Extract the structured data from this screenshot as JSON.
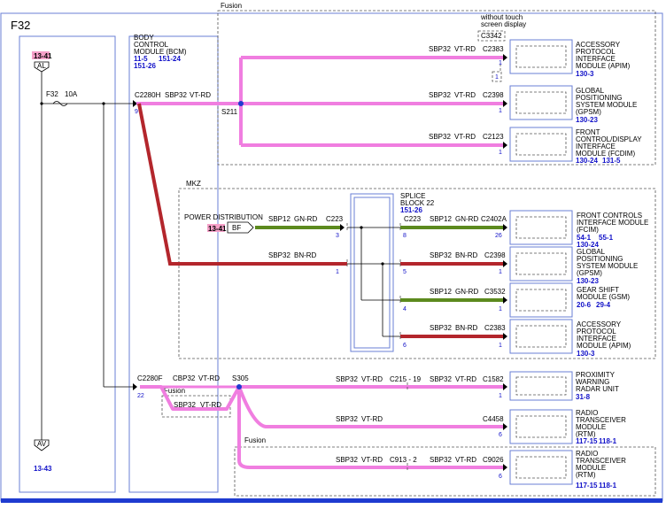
{
  "page": {
    "fuse_block": "F32"
  },
  "bcm": {
    "lines": [
      "BODY",
      "CONTROL",
      "MODULE (BCM)"
    ],
    "refs": [
      "11-5",
      "151-24",
      "151-26"
    ]
  },
  "fuse": {
    "name": "F32",
    "rating": "10A"
  },
  "left_stack": {
    "top_ref": "13-41",
    "top_label": "AL",
    "bottom_label": "AV",
    "bottom_ref": "13-43"
  },
  "fusion_top": {
    "title": "Fusion",
    "note_lines": [
      "without touch",
      "screen display"
    ],
    "note_connector": "C3342",
    "note_pin": "1",
    "splice": "S211",
    "bcm_connector": "C2280H",
    "bcm_pin": "9",
    "main_circuit": "SBP32",
    "main_color": "VT-RD"
  },
  "fusion_rows": [
    {
      "circuit": "SBP32",
      "color": "VT-RD",
      "connector": "C2383",
      "pin": "1",
      "name_lines": [
        "ACCESSORY",
        "PROTOCOL",
        "INTERFACE",
        "MODULE (APIM)"
      ],
      "refs": [
        "130-3"
      ]
    },
    {
      "circuit": "SBP32",
      "color": "VT-RD",
      "connector": "C2398",
      "pin": "1",
      "name_lines": [
        "GLOBAL",
        "POSITIONING",
        "SYSTEM MODULE",
        "(GPSM)"
      ],
      "refs": [
        "130-23"
      ]
    },
    {
      "circuit": "SBP32",
      "color": "VT-RD",
      "connector": "C2123",
      "pin": "1",
      "name_lines": [
        "FRONT",
        "CONTROL/DISPLAY",
        "INTERFACE",
        "MODULE (FCDIM)"
      ],
      "refs": [
        "130-24",
        "131-5"
      ]
    }
  ],
  "mkz": {
    "title": "MKZ",
    "splice_lines": [
      "SPLICE",
      "BLOCK 22"
    ],
    "splice_ref": "151-26",
    "power": {
      "label": "POWER DISTRIBUTION",
      "ref": "13-41",
      "tag": "BF"
    },
    "left_wires": [
      {
        "circuit": "SBP12",
        "color": "GN-RD",
        "connector": "C223",
        "pin": "3"
      },
      {
        "circuit": "SBP32",
        "color": "BN-RD",
        "connector": "",
        "pin": "1"
      }
    ],
    "rows": [
      {
        "splice_connector": "C223",
        "splice_pin": "8",
        "circuit": "SBP12",
        "color": "GN-RD",
        "connector": "C2402A",
        "pin": "26",
        "name_lines": [
          "FRONT CONTROLS",
          "INTERFACE MODULE",
          "(FCIM)"
        ],
        "refs": [
          "54-1",
          "55-1",
          "130-24"
        ]
      },
      {
        "splice_connector": "",
        "splice_pin": "5",
        "circuit": "SBP32",
        "color": "BN-RD",
        "connector": "C2398",
        "pin": "1",
        "name_lines": [
          "GLOBAL",
          "POSITIONING",
          "SYSTEM MODULE",
          "(GPSM)"
        ],
        "refs": [
          "130-23"
        ]
      },
      {
        "splice_connector": "",
        "splice_pin": "4",
        "circuit": "SBP12",
        "color": "GN-RD",
        "connector": "C3532",
        "pin": "1",
        "name_lines": [
          "GEAR SHIFT",
          "MODULE (GSM)"
        ],
        "refs": [
          "20-6",
          "29-4"
        ]
      },
      {
        "splice_connector": "",
        "splice_pin": "6",
        "circuit": "SBP32",
        "color": "BN-RD",
        "connector": "C2383",
        "pin": "1",
        "name_lines": [
          "ACCESSORY",
          "PROTOCOL",
          "INTERFACE",
          "MODULE (APIM)"
        ],
        "refs": [
          "130-3"
        ]
      }
    ]
  },
  "bottom": {
    "bcm_connector": "C2280F",
    "bcm_pin": "22",
    "circuit": "CBP32",
    "color": "VT-RD",
    "splice": "S305",
    "fusion_small": {
      "title": "Fusion",
      "circuit": "SBP32",
      "color": "VT-RD"
    },
    "fusion_lower_title": "Fusion",
    "rows": [
      {
        "circuit": "SBP32",
        "color": "VT-RD",
        "inline": "C215 - 19",
        "connector": "C1582",
        "pin": "1",
        "name_lines": [
          "PROXIMITY",
          "WARNING",
          "RADAR UNIT"
        ],
        "refs": [
          "31-8"
        ]
      },
      {
        "circuit": "SBP32",
        "color": "VT-RD",
        "inline": "",
        "connector": "C4458",
        "pin": "6",
        "name_lines": [
          "RADIO",
          "TRANSCEIVER",
          "MODULE",
          "(RTM)"
        ],
        "refs": [
          "117-15",
          "118-1"
        ]
      },
      {
        "circuit": "SBP32",
        "color": "VT-RD",
        "inline": "C913 - 2",
        "connector": "C9026",
        "pin": "6",
        "name_lines": [
          "RADIO",
          "TRANSCEIVER",
          "MODULE",
          "(RTM)"
        ],
        "refs": [
          "117-15",
          "118-1"
        ]
      }
    ]
  },
  "colors": {
    "violet_red": "#f07ee0",
    "brown_red": "#b3262c",
    "green_red": "#5c8a1e",
    "frame": "#6a7fd6",
    "ref_text": "#1010c8",
    "highlight": "#f5a0c8"
  }
}
